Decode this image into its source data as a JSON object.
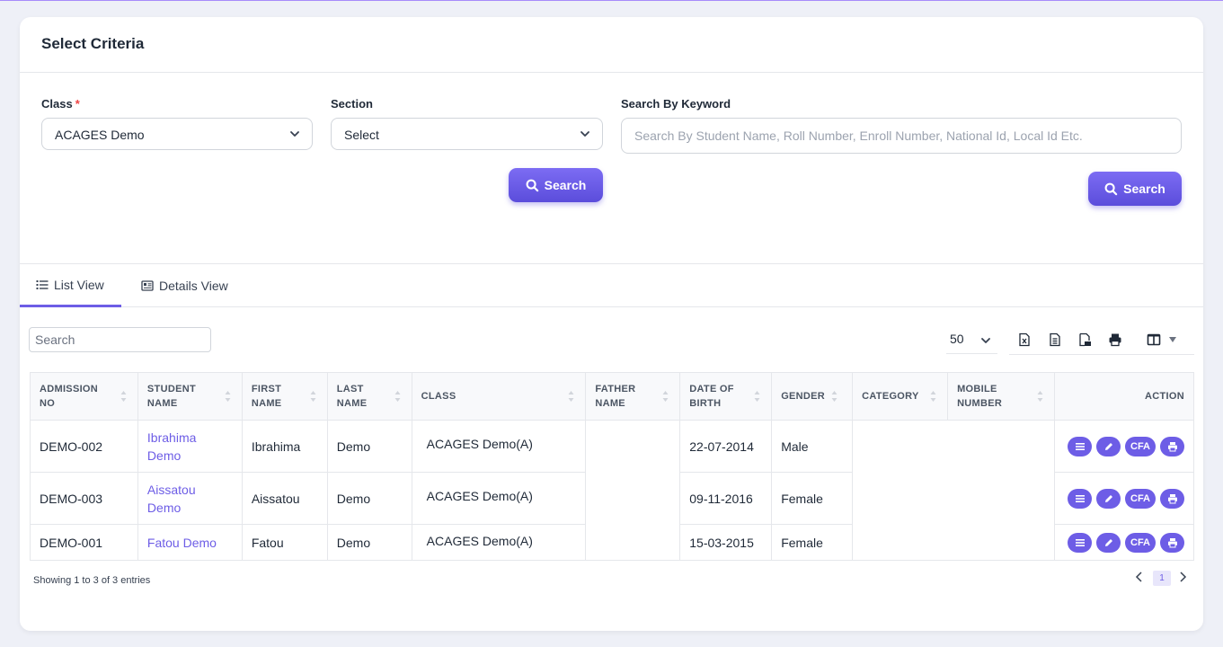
{
  "criteria": {
    "title": "Select Criteria",
    "class_label": "Class",
    "class_required": "*",
    "class_value": "ACAGES Demo",
    "section_label": "Section",
    "section_value": "Select",
    "keyword_label": "Search By Keyword",
    "keyword_placeholder": "Search By Student Name, Roll Number, Enroll Number, National Id, Local Id Etc.",
    "search_btn_1": "Search",
    "search_btn_2": "Search"
  },
  "tabs": [
    {
      "label": "List View",
      "icon": "list-icon",
      "active": true
    },
    {
      "label": "Details View",
      "icon": "details-icon",
      "active": false
    }
  ],
  "table_controls": {
    "search_placeholder": "Search",
    "page_size": "50",
    "tools": [
      "excel-icon",
      "csv-icon",
      "pdf-icon",
      "print-icon",
      "columns-icon"
    ]
  },
  "table": {
    "columns": [
      "ADMISSION NO",
      "STUDENT NAME",
      "FIRST NAME",
      "LAST NAME",
      "CLASS",
      "FATHER NAME",
      "DATE OF BIRTH",
      "GENDER",
      "CATEGORY",
      "MOBILE NUMBER",
      "ACTION"
    ],
    "rows": [
      {
        "admission_no": "DEMO-002",
        "student_name": "Ibrahima Demo",
        "first_name": "Ibrahima",
        "last_name": "Demo",
        "class": "ACAGES Demo(A)",
        "father_name": "",
        "dob": "22-07-2014",
        "gender": "Male",
        "category": "",
        "mobile": ""
      },
      {
        "admission_no": "DEMO-003",
        "student_name": "Aissatou Demo",
        "first_name": "Aissatou",
        "last_name": "Demo",
        "class": "ACAGES Demo(A)",
        "father_name": "",
        "dob": "09-11-2016",
        "gender": "Female",
        "category": "",
        "mobile": ""
      },
      {
        "admission_no": "DEMO-001",
        "student_name": "Fatou Demo",
        "first_name": "Fatou",
        "last_name": "Demo",
        "class": "ACAGES Demo(A)",
        "father_name": "",
        "dob": "15-03-2015",
        "gender": "Female",
        "category": "",
        "mobile": ""
      }
    ],
    "action_cfa_label": "CFA"
  },
  "footer": {
    "showing": "Showing 1 to 3 of 3 entries",
    "current_page": "1"
  },
  "colors": {
    "accent": "#6d5de6",
    "link": "#6d5de6"
  }
}
